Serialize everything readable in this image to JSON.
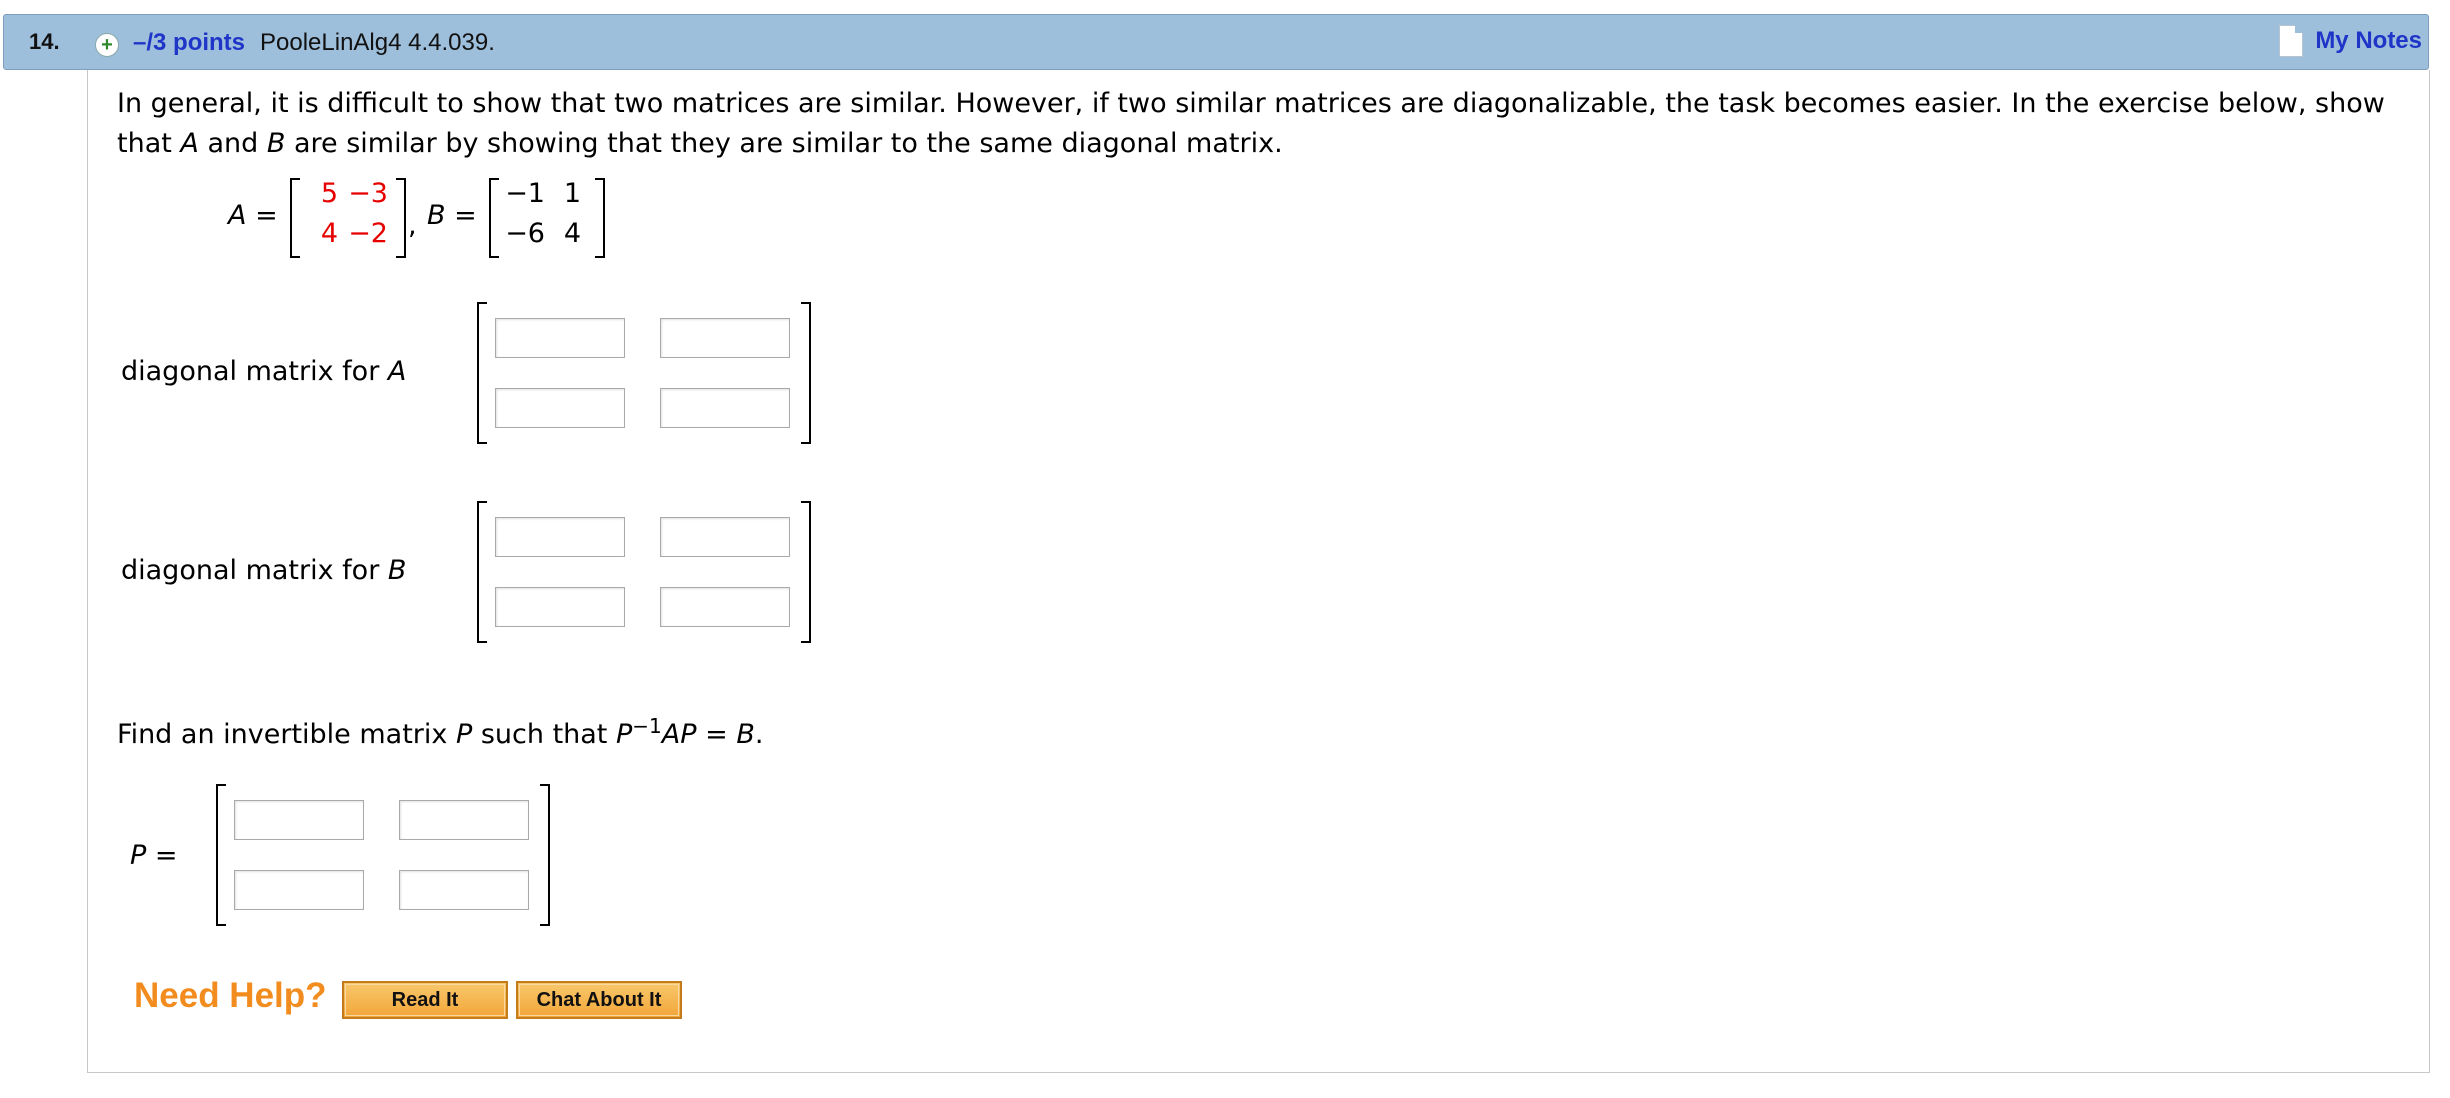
{
  "header": {
    "question_number": "14.",
    "points": "–/3 points",
    "problem_code": "PooleLinAlg4 4.4.039.",
    "my_notes": "My Notes"
  },
  "prompt": {
    "part1": "In general, it is difficult to show that two matrices are similar. However, if two similar matrices are diagonalizable, the task becomes easier. In the exercise below, show that ",
    "var_A": "A",
    "and": " and ",
    "var_B": "B",
    "part2": " are similar by showing that they are similar to the same diagonal matrix."
  },
  "matrices": {
    "A_label": "A =",
    "A": [
      [
        "5",
        "−3"
      ],
      [
        "4",
        "−2"
      ]
    ],
    "sep": ",",
    "B_label": "B =",
    "B": [
      [
        "−1",
        "1"
      ],
      [
        "−6",
        "4"
      ]
    ]
  },
  "diag_A": {
    "label": "diagonal matrix for ",
    "var": "A",
    "values": [
      "",
      "",
      "",
      ""
    ]
  },
  "diag_B": {
    "label": "diagonal matrix for ",
    "var": "B",
    "values": [
      "",
      "",
      "",
      ""
    ]
  },
  "find_P": {
    "text": "Find an invertible matrix ",
    "var": "P",
    "text2": " such that ",
    "eq_P": "P",
    "eq_exp": "−1",
    "eq_AP": "AP",
    "eq_rest": " = ",
    "eq_B": "B",
    "eq_end": "."
  },
  "P_matrix": {
    "label": "P",
    "eq": " =",
    "values": [
      "",
      "",
      "",
      ""
    ]
  },
  "help": {
    "need_help": "Need Help?",
    "read_it": "Read It",
    "chat": "Chat About It"
  },
  "colors": {
    "header_bg": "#9ebfdb",
    "link": "#1f35c8",
    "given_entries": "#e60000",
    "help": "#f28c1e"
  }
}
